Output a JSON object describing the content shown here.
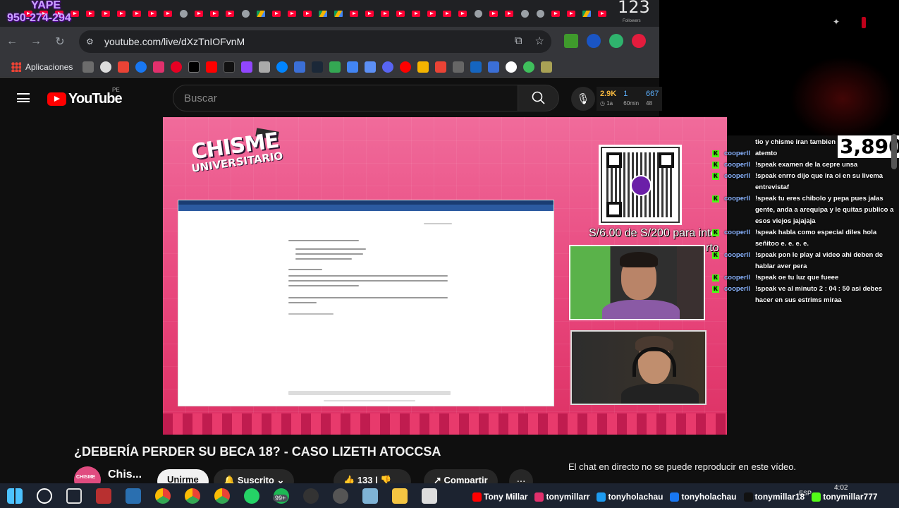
{
  "overlay": {
    "yape_title": "YAPE",
    "yape_phone": "950-274-294",
    "top_counter": "123",
    "followers_label": "Followers"
  },
  "browser": {
    "url": "youtube.com/live/dXzTnIOFvnM",
    "bookmarks_apps_label": "Aplicaciones"
  },
  "youtube": {
    "logo_text": "YouTube",
    "country_code": "PE",
    "search_placeholder": "Buscar",
    "stats": {
      "val1": "2.9K",
      "val2": "1",
      "val3": "667",
      "sub1": "1a",
      "sub2": "60min",
      "sub3": "48"
    }
  },
  "video": {
    "brand_line1": "CHISME",
    "brand_line2": "UNIVERSITARIO",
    "goal_text": "S/6.00 de S/200 para in",
    "goal_overlap": "rto",
    "goal_extra": "te"
  },
  "watch": {
    "title": "¿DEBERÍA PERDER SU BECA 18? - CASO LIZETH ATOCCSA",
    "channel_name": "Chis...",
    "avatar_text": "CHISME",
    "join_label": "Unirme",
    "subscribed_label": "Suscrito",
    "like_count": "133",
    "share_label": "Compartir",
    "more_label": "...",
    "chat_unavailable": "El chat en directo no se puede reproducir en este vídeo."
  },
  "chat": {
    "viewer_count": "3,890",
    "messages": [
      {
        "user": "",
        "text": "tio y chisme iran tambien"
      },
      {
        "user": "cooperll",
        "text": "atemto"
      },
      {
        "user": "cooperll",
        "text": "!speak examen de la cepre unsa"
      },
      {
        "user": "cooperll",
        "text": "!speak enrro dijo que ira oi en su livema entrevistaf"
      },
      {
        "user": "cooperll",
        "text": "!speak tu eres chibolo y pepa pues jalas gente, anda a arequipa y le quitas publico a esos viejos jajajaja"
      },
      {
        "user": "cooperll",
        "text": "!speak habla como especial diles hola señitoo e. e. e. e."
      },
      {
        "user": "cooperll",
        "text": "!speak pon le play al video ahi deben de hablar aver pera"
      },
      {
        "user": "cooperll",
        "text": "!speak oe tu luz que fueee"
      },
      {
        "user": "cooperll",
        "text": "!speak ve al minuto 2 : 04 : 50 asi debes hacer en sus estrims miraa"
      }
    ]
  },
  "taskbar": {
    "badge": "99+",
    "socials": [
      {
        "handle": "Tony Millar",
        "icon": "youtube-icon",
        "color": "#ff0000"
      },
      {
        "handle": "tonymillarr",
        "icon": "instagram-icon",
        "color": "#e1306c"
      },
      {
        "handle": "tonyholachau",
        "icon": "twitter-icon",
        "color": "#1d9bf0"
      },
      {
        "handle": "tonyholachau",
        "icon": "facebook-icon",
        "color": "#1877f2"
      },
      {
        "handle": "tonymillar18",
        "icon": "tiktok-icon",
        "color": "#111111"
      },
      {
        "handle": "tonymillar777",
        "icon": "kick-icon",
        "color": "#53fc18"
      }
    ],
    "time": "4:02",
    "lang": "ESP"
  }
}
